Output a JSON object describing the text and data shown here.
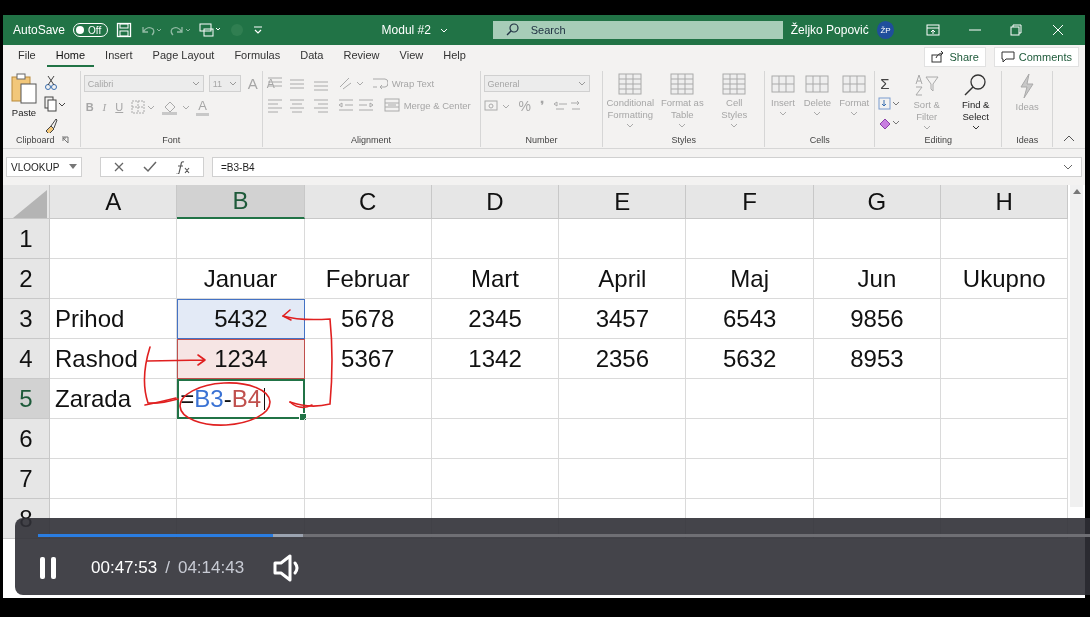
{
  "title_bar": {
    "autosave_label": "AutoSave",
    "autosave": {
      "on": false,
      "label": "Off"
    },
    "document": "Modul #2",
    "search_placeholder": "Search",
    "user": "Željko Popović",
    "initials": "ŽP"
  },
  "menu_tabs": [
    {
      "label": "File",
      "selected": false
    },
    {
      "label": "Home",
      "selected": true
    },
    {
      "label": "Insert",
      "selected": false
    },
    {
      "label": "Page Layout",
      "selected": false
    },
    {
      "label": "Formulas",
      "selected": false
    },
    {
      "label": "Data",
      "selected": false
    },
    {
      "label": "Review",
      "selected": false
    },
    {
      "label": "View",
      "selected": false
    },
    {
      "label": "Help",
      "selected": false
    }
  ],
  "share": "Share",
  "comments": "Comments",
  "ribbon": {
    "clipboard": {
      "title": "Clipboard",
      "paste": {
        "label": "Paste",
        "disabled": false
      }
    },
    "font": {
      "title": "Font",
      "name": "Calibri",
      "size": "11",
      "grow": "A",
      "shrink": "A",
      "bold": "B",
      "italic": "I",
      "underline": "U",
      "font_color_button": "A",
      "disabled": true
    },
    "alignment": {
      "title": "Alignment",
      "wrap": "Wrap Text",
      "merge": "Merge & Center",
      "disabled": true
    },
    "number": {
      "title": "Number",
      "format": "General",
      "percent": "%",
      "comma": "❜",
      "disabled": true
    },
    "styles": {
      "title": "Styles",
      "commands": [
        {
          "label": "Conditional Formatting",
          "disabled": true
        },
        {
          "label": "Format as Table",
          "disabled": true
        },
        {
          "label": "Cell Styles",
          "disabled": true
        }
      ]
    },
    "cells": {
      "title": "Cells",
      "commands": [
        {
          "label": "Insert",
          "disabled": true
        },
        {
          "label": "Delete",
          "disabled": true
        },
        {
          "label": "Format",
          "disabled": true
        }
      ]
    },
    "editing": {
      "title": "Editing",
      "sum": "Σ",
      "commands": [
        {
          "label": "Sort & Filter",
          "disabled": true
        },
        {
          "label": "Find & Select",
          "disabled": false
        }
      ]
    },
    "ideas": {
      "title": "Ideas",
      "commands": [
        {
          "label": "Ideas",
          "disabled": true
        }
      ]
    }
  },
  "formula_bar": {
    "name_box": "VLOOKUP",
    "formula": "=B3-B4"
  },
  "columns": [
    {
      "label": "A",
      "selected": false
    },
    {
      "label": "B",
      "selected": true
    },
    {
      "label": "C",
      "selected": false
    },
    {
      "label": "D",
      "selected": false
    },
    {
      "label": "E",
      "selected": false
    },
    {
      "label": "F",
      "selected": false
    },
    {
      "label": "G",
      "selected": false
    },
    {
      "label": "H",
      "selected": false
    }
  ],
  "rows": [
    {
      "header": "1",
      "selected": false,
      "cells": [
        null,
        null,
        null,
        null,
        null,
        null,
        null,
        null
      ]
    },
    {
      "header": "2",
      "selected": false,
      "cells": [
        null,
        {
          "text": "Januar"
        },
        {
          "text": "Februar"
        },
        {
          "text": "Mart"
        },
        {
          "text": "April"
        },
        {
          "text": "Maj"
        },
        {
          "text": "Jun"
        },
        {
          "text": "Ukupno"
        }
      ]
    },
    {
      "header": "3",
      "selected": false,
      "cells": [
        {
          "text": "Prihod"
        },
        {
          "text": "5432",
          "color": "#4472c4"
        },
        {
          "text": "5678"
        },
        {
          "text": "2345"
        },
        {
          "text": "3457"
        },
        {
          "text": "6543"
        },
        {
          "text": "9856"
        },
        null
      ]
    },
    {
      "header": "4",
      "selected": false,
      "cells": [
        {
          "text": "Rashod"
        },
        {
          "text": "1234",
          "color": "#c0504d"
        },
        {
          "text": "5367"
        },
        {
          "text": "1342"
        },
        {
          "text": "2356"
        },
        {
          "text": "5632"
        },
        {
          "text": "8953"
        },
        null
      ]
    },
    {
      "header": "5",
      "selected": true,
      "cells": [
        {
          "text": "Zarada"
        },
        {
          "parts": [
            {
              "text": "="
            },
            {
              "text": "B3",
              "color": "#3a72d4"
            },
            {
              "text": "-"
            },
            {
              "text": "B4",
              "color": "#c0504d"
            }
          ]
        },
        null,
        null,
        null,
        null,
        null,
        null
      ]
    },
    {
      "header": "6",
      "selected": false,
      "cells": [
        null,
        null,
        null,
        null,
        null,
        null,
        null,
        null
      ]
    },
    {
      "header": "7",
      "selected": false,
      "cells": [
        null,
        null,
        null,
        null,
        null,
        null,
        null,
        null
      ]
    },
    {
      "header": "8",
      "selected": false,
      "cells": [
        null,
        null,
        null,
        null,
        null,
        null,
        null,
        null
      ]
    }
  ],
  "player": {
    "playing": true,
    "position": "00:47:53",
    "separator": "/",
    "duration": "04:14:43",
    "progress": {
      "level": 0.223
    },
    "buffered": {
      "level": 0.252
    },
    "muted": false
  }
}
